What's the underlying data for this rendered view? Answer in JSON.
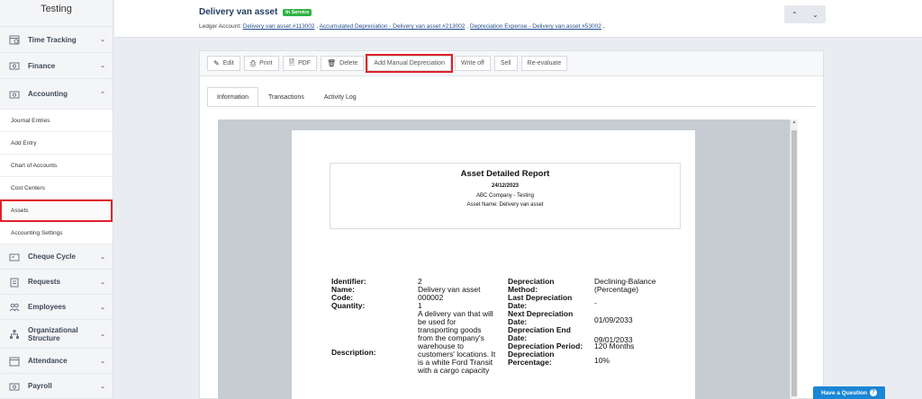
{
  "sidebar": {
    "brand": "Testing",
    "items_top": [
      {
        "label": "Time Tracking",
        "icon": "calendar-clock-icon"
      },
      {
        "label": "Finance",
        "icon": "money-icon"
      }
    ],
    "accounting": {
      "label": "Accounting",
      "icon": "accounting-icon"
    },
    "sub_items": [
      "Journal Entries",
      "Add Entry",
      "Chart of Accounts",
      "Cost Centers",
      "Assets",
      "Accounting Settings"
    ],
    "items_bottom": [
      {
        "label": "Cheque Cycle",
        "icon": "cheque-icon"
      },
      {
        "label": "Requests",
        "icon": "clipboard-icon"
      },
      {
        "label": "Employees",
        "icon": "users-icon"
      },
      {
        "label": "Organizational Structure",
        "icon": "org-chart-icon"
      },
      {
        "label": "Attendance",
        "icon": "calendar-icon"
      },
      {
        "label": "Payroll",
        "icon": "payroll-icon"
      }
    ]
  },
  "header": {
    "title": "Delivery van asset",
    "status": "In Service",
    "ledger_label": "Ledger Account:",
    "ledger_links": [
      "Delivery van asset #113002",
      "Accumulated Depreciation - Delivery van asset #213002",
      "Depreciation Expense - Delivery van asset #53002"
    ]
  },
  "toolbar": {
    "edit": "Edit",
    "print": "Print",
    "pdf": "PDF",
    "delete": "Delete",
    "add_manual_depreciation": "Add Manual Depreciation",
    "write_off": "Write off",
    "sell": "Sell",
    "re_evaluate": "Re-evaluate"
  },
  "tabs": [
    "Information",
    "Transactions",
    "Activity Log"
  ],
  "report": {
    "title": "Asset Detailed Report",
    "date": "24/12/2023",
    "company": "ABC Company - Testing",
    "asset_name_line": "Asset Name: Delivery van asset",
    "labels_left": [
      "Identifier:",
      "Name:",
      "Code:",
      "Quantity:",
      "Description:"
    ],
    "values_left": {
      "identifier": "2",
      "name": "Delivery van asset",
      "code": "000002",
      "quantity": "1",
      "description_lines": [
        "A delivery van that will",
        "be used for",
        "transporting goods",
        "from the company's",
        "warehouse to",
        "customers' locations. It",
        "is a white Ford Transit",
        "with a cargo capacity"
      ]
    },
    "labels_right": {
      "method_1": "Depreciation",
      "method_2": "Method:",
      "last_1": "Last Depreciation",
      "last_2": "Date:",
      "next_1": "Next Depreciation",
      "next_2": "Date:",
      "end_1": "Depreciation End",
      "end_2": "Date:",
      "period": "Depreciation Period:",
      "pct_1": "Depreciation",
      "pct_2": "Percentage:"
    },
    "values_right": {
      "method_1": "Declining-Balance",
      "method_2": "(Percentage)",
      "last": "-",
      "next": "01/09/2033",
      "end": "09/01/2033",
      "period": "120 Months",
      "pct": "10%"
    }
  },
  "help": {
    "label": "Have a Question"
  },
  "colors": {
    "accent_red": "#e0202a",
    "badge_green": "#2fb344",
    "help_blue": "#1a86d6",
    "title_navy": "#1f3a5c"
  }
}
